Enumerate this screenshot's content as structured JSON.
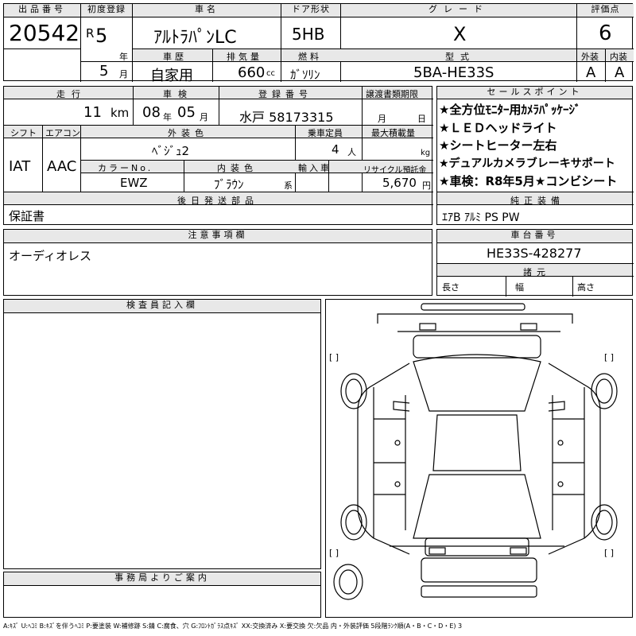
{
  "header": {
    "lot_label": "出品番号",
    "lot_no": "20542",
    "first_reg_label": "初度登録",
    "era": "R",
    "year": "5",
    "year_unit": "年",
    "month": "5",
    "month_unit": "月",
    "model_label": "車名",
    "model": "ｱﾙﾄﾗﾊﾟﾝLC",
    "door_label": "ドア形状",
    "door": "5HB",
    "grade_label": "グレード",
    "grade": "X",
    "score_label": "評価点",
    "score": "6",
    "history_label": "車歴",
    "history": "自家用",
    "disp_label": "排気量",
    "disp": "660",
    "disp_unit": "cc",
    "fuel_label": "燃料",
    "fuel": "ｶﾞｿﾘﾝ",
    "type_label": "型式",
    "type": "5BA-HE33S",
    "ext_label": "外装",
    "ext": "A",
    "int_label": "内装",
    "int": "A"
  },
  "row2": {
    "mileage_label": "走行",
    "mileage": "11",
    "mileage_unit": "km",
    "inspection_label": "車検",
    "insp_year": "08",
    "insp_year_unit": "年",
    "insp_month": "05",
    "insp_month_unit": "月",
    "plate_label": "登録番号",
    "plate": "水戸 58173315",
    "transfer_label": "譲渡書類期限",
    "transfer_month": "月",
    "transfer_day": "日",
    "shift_label": "シフト",
    "shift": "IAT",
    "ac_label": "エアコン",
    "ac": "AAC",
    "color_label": "外装色",
    "color": "ﾍﾞｼﾞｭ2",
    "capacity_label": "乗車定員",
    "capacity": "4",
    "capacity_unit": "人",
    "load_label": "最大積載量",
    "load_unit": "kg",
    "color_no_label": "カラーNo.",
    "color_no": "EWZ",
    "interior_color_label": "内装色",
    "interior_color": "ﾌﾞﾗｳﾝ",
    "interior_color_suffix": "系",
    "import_label": "輸入車",
    "recycle_label": "リサイクル預託金",
    "recycle": "5,670",
    "recycle_unit": "円",
    "later_parts_label": "後日発送部品",
    "later_parts": "保証書"
  },
  "sales": {
    "label": "セールスポイント",
    "points": [
      "★全方位ﾓﾆﾀｰ用ｶﾒﾗﾊﾟｯｹｰｼﾞ",
      "★ＬＥＤヘッドライト",
      "★シートヒーター左右",
      "★デュアルカメラブレーキサポート",
      "★車検：R8年5月★コンビシート"
    ],
    "equip_label": "純正装備",
    "equip": "ｴｱB ｱﾙﾐ PS PW"
  },
  "notes": {
    "label": "注意事項欄",
    "text": "オーディオレス"
  },
  "chassis": {
    "label": "車台番号",
    "number": "HE33S-428277",
    "dims_label": "諸元",
    "length": "長さ",
    "width": "幅",
    "height": "高さ"
  },
  "inspector": {
    "label": "検査員記入欄"
  },
  "office": {
    "label": "事務局よりご案内"
  },
  "diagram": {
    "bracket": "[ ]"
  },
  "legend": "A:ｷｽﾞ U:ﾍｺﾐ B:ｷｽﾞを伴うﾍｺﾐ P:要塗装 W:補修跡 S:錆 C:腐食、穴 G:ﾌﾛﾝﾄｶﾞﾗｽ点ｷｽﾞ XX:交換済み X:要交換 欠:欠品 内・外装評価 5段階ﾗﾝｸ順(A・B・C・D・E) 3"
}
